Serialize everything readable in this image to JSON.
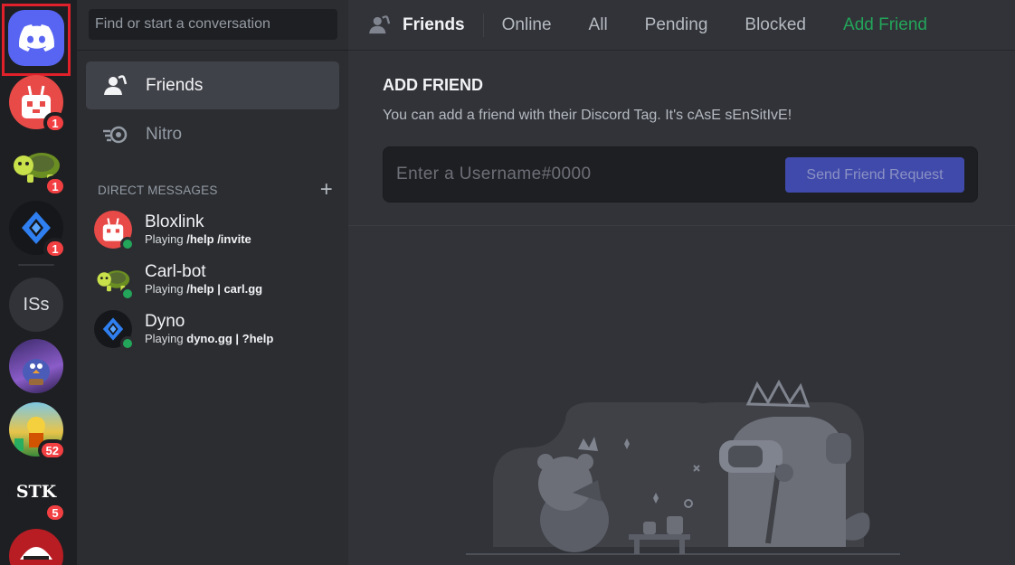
{
  "rail": {
    "home_icon": "discord-logo-icon",
    "servers": [
      {
        "name": "bloxlink-server",
        "badge": "1"
      },
      {
        "name": "carl-bot-server",
        "badge": "1"
      },
      {
        "name": "dyno-server",
        "badge": "1"
      },
      {
        "name": "iss-server",
        "initials": "ISs"
      },
      {
        "name": "bird-server"
      },
      {
        "name": "cartoon-server",
        "badge": "52"
      },
      {
        "name": "stk-server",
        "initials": "STK",
        "badge": "5"
      },
      {
        "name": "football-server"
      }
    ]
  },
  "sidebar": {
    "search_placeholder": "Find or start a conversation",
    "nav": {
      "friends": "Friends",
      "nitro": "Nitro"
    },
    "dm_header": "DIRECT MESSAGES",
    "dm_add": "+",
    "dms": [
      {
        "name": "Bloxlink",
        "status_prefix": "Playing ",
        "status_game": "/help /invite"
      },
      {
        "name": "Carl-bot",
        "status_prefix": "Playing ",
        "status_game": "/help | carl.gg"
      },
      {
        "name": "Dyno",
        "status_prefix": "Playing ",
        "status_game": "dyno.gg | ?help"
      }
    ]
  },
  "topbar": {
    "title": "Friends",
    "tabs": [
      "Online",
      "All",
      "Pending",
      "Blocked"
    ],
    "add_friend": "Add Friend"
  },
  "add_friend": {
    "title": "ADD FRIEND",
    "subtitle": "You can add a friend with their Discord Tag. It's cAsE sEnSitIvE!",
    "placeholder": "Enter a Username#0000",
    "button": "Send Friend Request"
  },
  "colors": {
    "blurple": "#5865f2",
    "green": "#23a55a",
    "red_badge": "#f23f42",
    "highlight_frame": "#e0202a"
  }
}
